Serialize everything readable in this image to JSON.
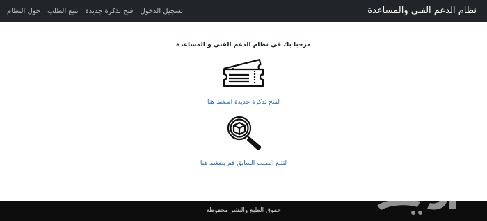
{
  "navbar": {
    "brand": "نظام الدعم الفني والمساعدة",
    "links": [
      "حول النظام",
      "تتبع الطلب",
      "فتح تذكرة جديدة",
      "تسجيل الدخول"
    ]
  },
  "main": {
    "welcome": "مرحبا بك في نظام الدعم الفني و المساعدة",
    "new_ticket_link": "لفتح تذكرة جديدة اضغط هنا",
    "track_link": "لتتبع الطلب السابق قم بضغط هنا"
  },
  "footer": {
    "text": "حقوق الطبع والنشر محفوظة"
  },
  "icons": {
    "tickets": "tickets-icon",
    "search": "magnifier-box-icon"
  },
  "colors": {
    "navbar": "#212529",
    "link": "#2a6db5",
    "footer": "#0d0d0d"
  }
}
